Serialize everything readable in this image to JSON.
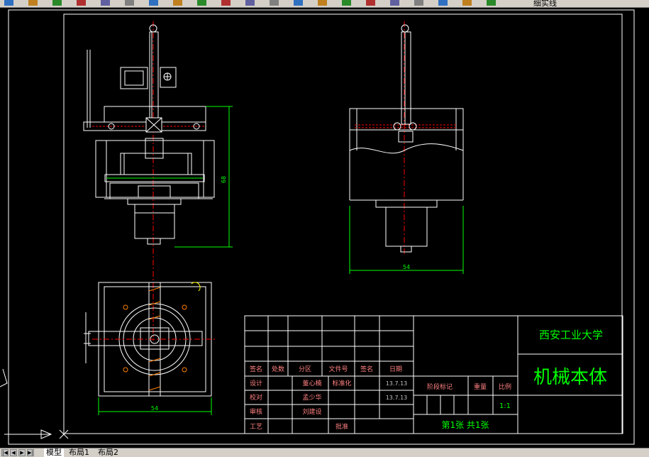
{
  "app": {
    "layer_name": "细实线",
    "tabs": [
      "模型",
      "布局1",
      "布局2"
    ]
  },
  "toolbar_icons": [
    "open-icon",
    "save-icon",
    "print-icon",
    "cut-icon",
    "copy-icon",
    "paste-icon",
    "match-properties-icon",
    "undo-icon",
    "redo-icon",
    "pan-icon",
    "zoom-realtime-icon",
    "zoom-window-icon",
    "zoom-previous-icon",
    "properties-icon",
    "design-center-icon",
    "tool-palettes-icon",
    "markup-icon",
    "calculator-icon",
    "help-icon",
    "layer-manager-icon",
    "layer-state-icon"
  ],
  "drawing": {
    "dimensions": {
      "height_dim": "68",
      "width_dim_right": "54",
      "width_dim_bottom": "54"
    }
  },
  "title_block": {
    "university": "西安工业大学",
    "part_name": "机械本体",
    "sheet_info": "第1张  共1张",
    "scale_label": "比例",
    "scale_value": "1:1",
    "weight_label": "重量",
    "stage_label": "阶段标记",
    "header_row": [
      "签名",
      "处数",
      "分区",
      "文件号",
      "签名",
      "日期"
    ],
    "rows": [
      {
        "role": "设计",
        "name": "董心楠",
        "extra": "标准化",
        "date": "13.7.13"
      },
      {
        "role": "校对",
        "name": "孟少华",
        "extra": "",
        "date": "13.7.13"
      },
      {
        "role": "审核",
        "name": "刘建设",
        "extra": "",
        "date": ""
      },
      {
        "role": "工艺",
        "name": "",
        "extra": "批准",
        "date": ""
      }
    ]
  },
  "colors": {
    "background": "#000000",
    "lines": "#ffffff",
    "dimension": "#00ff00",
    "centerline": "#ff0000",
    "title_text": "#00ff00",
    "table_text": "#ff8080",
    "date_text": "#c0c0c0"
  }
}
